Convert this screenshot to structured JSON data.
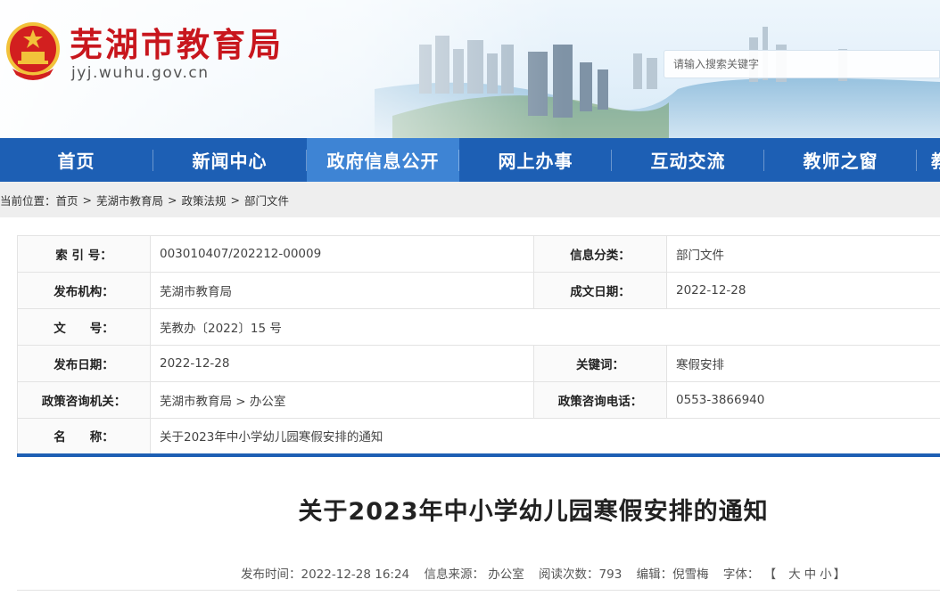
{
  "header": {
    "site_title": "芜湖市教育局",
    "site_url": "jyj.wuhu.gov.cn",
    "search_placeholder": "请输入搜索关键字"
  },
  "nav": {
    "items": [
      {
        "label": "首页"
      },
      {
        "label": "新闻中心"
      },
      {
        "label": "政府信息公开",
        "active": true
      },
      {
        "label": "网上办事"
      },
      {
        "label": "互动交流"
      },
      {
        "label": "教师之窗"
      },
      {
        "label": "教"
      }
    ]
  },
  "breadcrumb": {
    "prefix": "当前位置：",
    "items": [
      "首页",
      "芜湖市教育局",
      "政策法规",
      "部门文件"
    ],
    "separator": ">"
  },
  "info": {
    "index_label": "索 引 号：",
    "index_value": "003010407/202212-00009",
    "category_label": "信息分类：",
    "category_value": "部门文件",
    "publisher_label": "发布机构：",
    "publisher_value": "芜湖市教育局",
    "created_label": "成文日期：",
    "created_value": "2022-12-28",
    "docno_label": "文　　号：",
    "docno_value": "芜教办〔2022〕15 号",
    "pubdate_label": "发布日期：",
    "pubdate_value": "2022-12-28",
    "keyword_label": "关键词：",
    "keyword_value": "寒假安排",
    "consult_org_label": "政策咨询机关：",
    "consult_org_value": "芜湖市教育局 > 办公室",
    "consult_tel_label": "政策咨询电话：",
    "consult_tel_value": "0553-3866940",
    "name_label": "名　　称：",
    "name_value": "关于2023年中小学幼儿园寒假安排的通知"
  },
  "article": {
    "title": "关于2023年中小学幼儿园寒假安排的通知",
    "publish_time": "发布时间：2022-12-28 16:24",
    "source": "信息来源： 办公室",
    "views": "阅读次数：793",
    "editor": "编辑：倪雪梅",
    "font_label": "字体：",
    "font_open": "【",
    "font_large": "大",
    "font_medium": "中",
    "font_small": "小",
    "font_close": "】"
  },
  "colors": {
    "brand_red": "#c8161d",
    "nav_blue": "#1d5fb4",
    "nav_active": "#3e84d4"
  }
}
